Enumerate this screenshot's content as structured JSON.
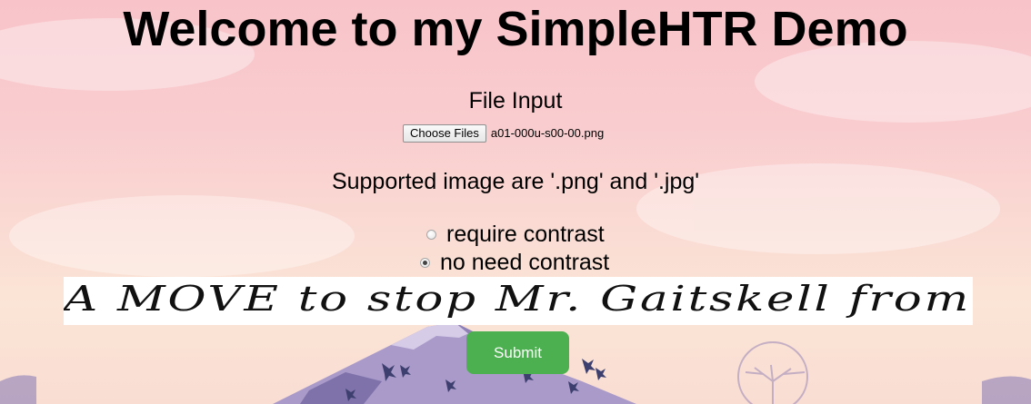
{
  "page": {
    "title": "Welcome to my SimpleHTR Demo"
  },
  "file_input": {
    "section_label": "File Input",
    "button_label": "Choose Files",
    "selected_file": "a01-000u-s00-00.png"
  },
  "supported_text": "Supported image are '.png' and '.jpg'",
  "contrast_options": [
    {
      "label": "require contrast",
      "checked": false
    },
    {
      "label": "no need contrast",
      "checked": true
    }
  ],
  "preview": {
    "handwritten_text": "A MOVE to stop Mr. Gaitskell from"
  },
  "submit": {
    "label": "Submit"
  },
  "colors": {
    "submit_button": "#4caf50",
    "background_top": "#f8c4c9",
    "mountain": "#a99ac9"
  }
}
